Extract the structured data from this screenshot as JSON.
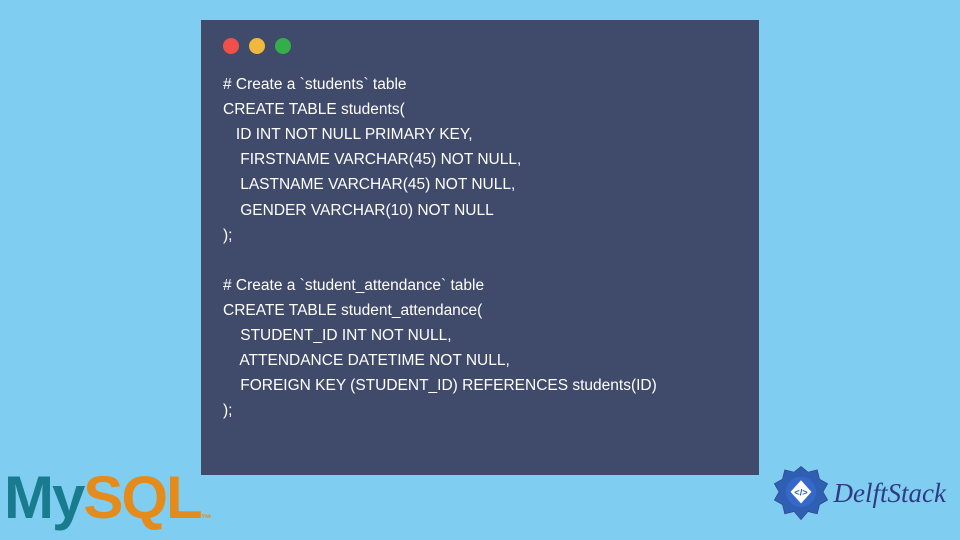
{
  "window": {
    "dots": [
      "red",
      "yellow",
      "green"
    ]
  },
  "code": {
    "text": "# Create a `students` table\nCREATE TABLE students(\n   ID INT NOT NULL PRIMARY KEY,\n    FIRSTNAME VARCHAR(45) NOT NULL,\n    LASTNAME VARCHAR(45) NOT NULL,\n    GENDER VARCHAR(10) NOT NULL\n);\n\n# Create a `student_attendance` table\nCREATE TABLE student_attendance(\n    STUDENT_ID INT NOT NULL,\n    ATTENDANCE DATETIME NOT NULL,\n    FOREIGN KEY (STUDENT_ID) REFERENCES students(ID)\n);"
  },
  "logo_mysql": {
    "part1": "My",
    "part2": "SQL",
    "tm": "™"
  },
  "logo_delft": {
    "text": "DelftStack"
  }
}
